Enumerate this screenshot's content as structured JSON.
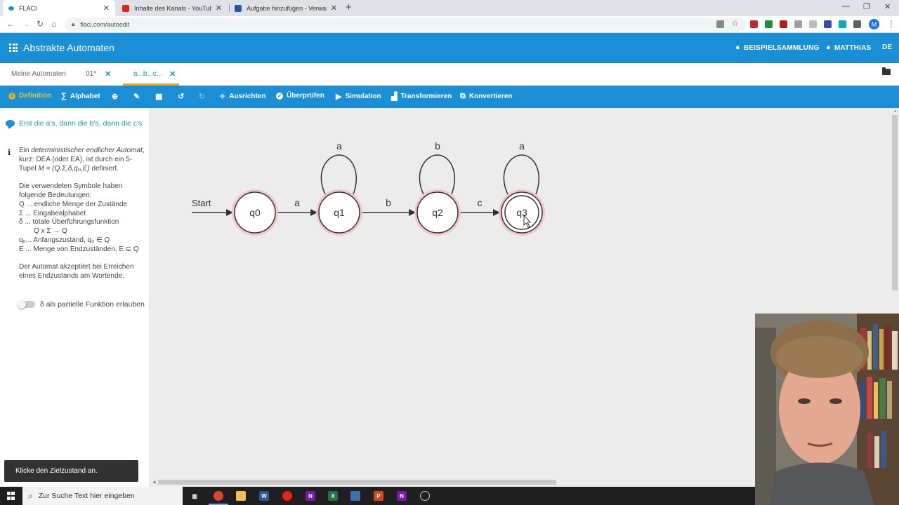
{
  "browser": {
    "tabs": [
      {
        "title": "FLACI",
        "active": true
      },
      {
        "title": "Inhalte des Kanals - YouTube Studio"
      },
      {
        "title": "Aufgabe hinzufügen - Verwaltung"
      }
    ],
    "new_tab_glyph": "+",
    "url": "flaci.com/autoedit",
    "profile_initial": "M"
  },
  "app": {
    "title": "Abstrakte Automaten",
    "header_items": {
      "examples": "BEISPIELSAMMLUNG",
      "user": "MATTHIAS",
      "lang": "DE"
    },
    "subtabs": {
      "my_automata": "Meine Automaten",
      "tab1": "01*",
      "tab2": "a...b...c..."
    }
  },
  "toolbar": {
    "definition": "Definition",
    "alphabet": "Alphabet",
    "align": "Ausrichten",
    "check": "Überprüfen",
    "simulation": "Simulation",
    "transform": "Transformieren",
    "convert": "Konvertieren"
  },
  "left_panel": {
    "description": "Erst die a's, dann die b's, dann die c's",
    "info_lines": {
      "l1a": "Ein ",
      "l1b": "deterministischer endlicher Automat",
      "l1c": ", kurz: DEA (oder EA), ist durch ein 5-Tupel ",
      "l1d": "M = (Q,Σ,δ,q₀,E)",
      "l1e": " definiert.",
      "p2": "Die verwendeten Symbole haben folgende Bedeutungen:",
      "q": "Q ... endliche Menge der Zustände",
      "sigma": "Σ ... Eingabealphabet",
      "delta": "δ ... totale Überführungsfunktion",
      "delta2": "Q x Σ → Q",
      "q0": "q₀... Anfangszustand, q₀ ∈ Q",
      "e": "E ... Menge von Endzuständen, E ⊆ Q",
      "p3": "Der Automat akzeptiert bei Erreichen eines Endzustands am Wortende."
    },
    "toggle_label": "δ als partielle Funktion erlauben",
    "toggle_on": false
  },
  "automaton": {
    "start_label": "Start",
    "states": [
      {
        "id": "q0",
        "accepting": false
      },
      {
        "id": "q1",
        "accepting": false
      },
      {
        "id": "q2",
        "accepting": false
      },
      {
        "id": "q3",
        "accepting": true
      }
    ],
    "transitions": [
      {
        "from": "q0",
        "to": "q1",
        "label": "a"
      },
      {
        "from": "q1",
        "to": "q1",
        "label": "a"
      },
      {
        "from": "q1",
        "to": "q2",
        "label": "b"
      },
      {
        "from": "q2",
        "to": "q2",
        "label": "b"
      },
      {
        "from": "q2",
        "to": "q3",
        "label": "c"
      },
      {
        "from": "q3",
        "to": "q3",
        "label": "a"
      }
    ]
  },
  "toast": "Klicke den Zielzustand an.",
  "taskbar": {
    "search_placeholder": "Zur Suche Text hier eingeben"
  }
}
